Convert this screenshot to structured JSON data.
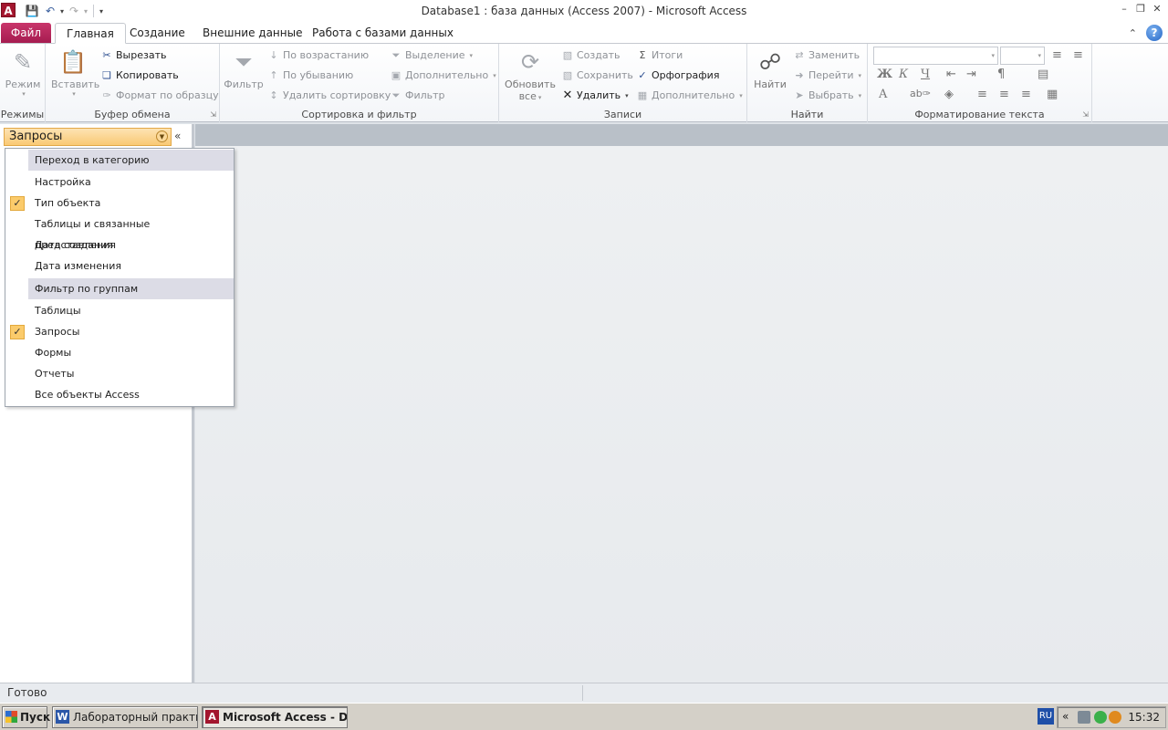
{
  "window": {
    "app_icon": "A",
    "title": "Database1 : база данных (Access 2007)  -  Microsoft Access"
  },
  "tabs": {
    "file": "Файл",
    "items": [
      "Главная",
      "Создание",
      "Внешние данные",
      "Работа с базами данных"
    ]
  },
  "ribbon": {
    "views": {
      "mode": "Режим",
      "label": "Режимы"
    },
    "clipboard": {
      "paste": "Вставить",
      "cut": "Вырезать",
      "copy": "Копировать",
      "format_painter": "Формат по образцу",
      "label": "Буфер обмена"
    },
    "sort_filter": {
      "filter": "Фильтр",
      "ascending": "По возрастанию",
      "descending": "По убыванию",
      "remove_sort": "Удалить сортировку",
      "selection": "Выделение",
      "advanced": "Дополнительно",
      "toggle_filter": "Фильтр",
      "label": "Сортировка и фильтр"
    },
    "records": {
      "refresh": "Обновить",
      "refresh_line2": "все",
      "new": "Создать",
      "save": "Сохранить",
      "delete": "Удалить",
      "totals": "Итоги",
      "spelling": "Орфография",
      "more": "Дополнительно",
      "label": "Записи"
    },
    "find": {
      "find": "Найти",
      "replace": "Заменить",
      "goto": "Перейти",
      "select": "Выбрать",
      "label": "Найти"
    },
    "text_format": {
      "bold": "Ж",
      "italic": "К",
      "underline": "Ч",
      "font_color": "A",
      "label": "Форматирование текста"
    }
  },
  "nav_pane": {
    "header": "Запросы",
    "collapse": "«"
  },
  "menu": {
    "items": [
      {
        "text": "Переход в категорию",
        "section": true,
        "checked": false
      },
      {
        "text": "Настройка",
        "section": false,
        "checked": false
      },
      {
        "text": "Тип объекта",
        "section": false,
        "checked": true
      },
      {
        "text": "Таблицы и связанные представления",
        "section": false,
        "checked": false
      },
      {
        "text": "Дата создания",
        "section": false,
        "checked": false
      },
      {
        "text": "Дата изменения",
        "section": false,
        "checked": false
      },
      {
        "text": "Фильтр по группам",
        "section": true,
        "checked": false
      },
      {
        "text": "Таблицы",
        "section": false,
        "checked": false
      },
      {
        "text": "Запросы",
        "section": false,
        "checked": true
      },
      {
        "text": "Формы",
        "section": false,
        "checked": false
      },
      {
        "text": "Отчеты",
        "section": false,
        "checked": false
      },
      {
        "text": "Все объекты Access",
        "section": false,
        "checked": false
      }
    ]
  },
  "status": {
    "text": "Готово"
  },
  "taskbar": {
    "start": "Пуск",
    "tasks": [
      {
        "icon": "W",
        "label": "Лабораторный практик..."
      },
      {
        "icon": "A",
        "label": "Microsoft Access - Da..."
      }
    ],
    "lang": "RU",
    "tray_chevron": "«",
    "clock": "15:32"
  }
}
